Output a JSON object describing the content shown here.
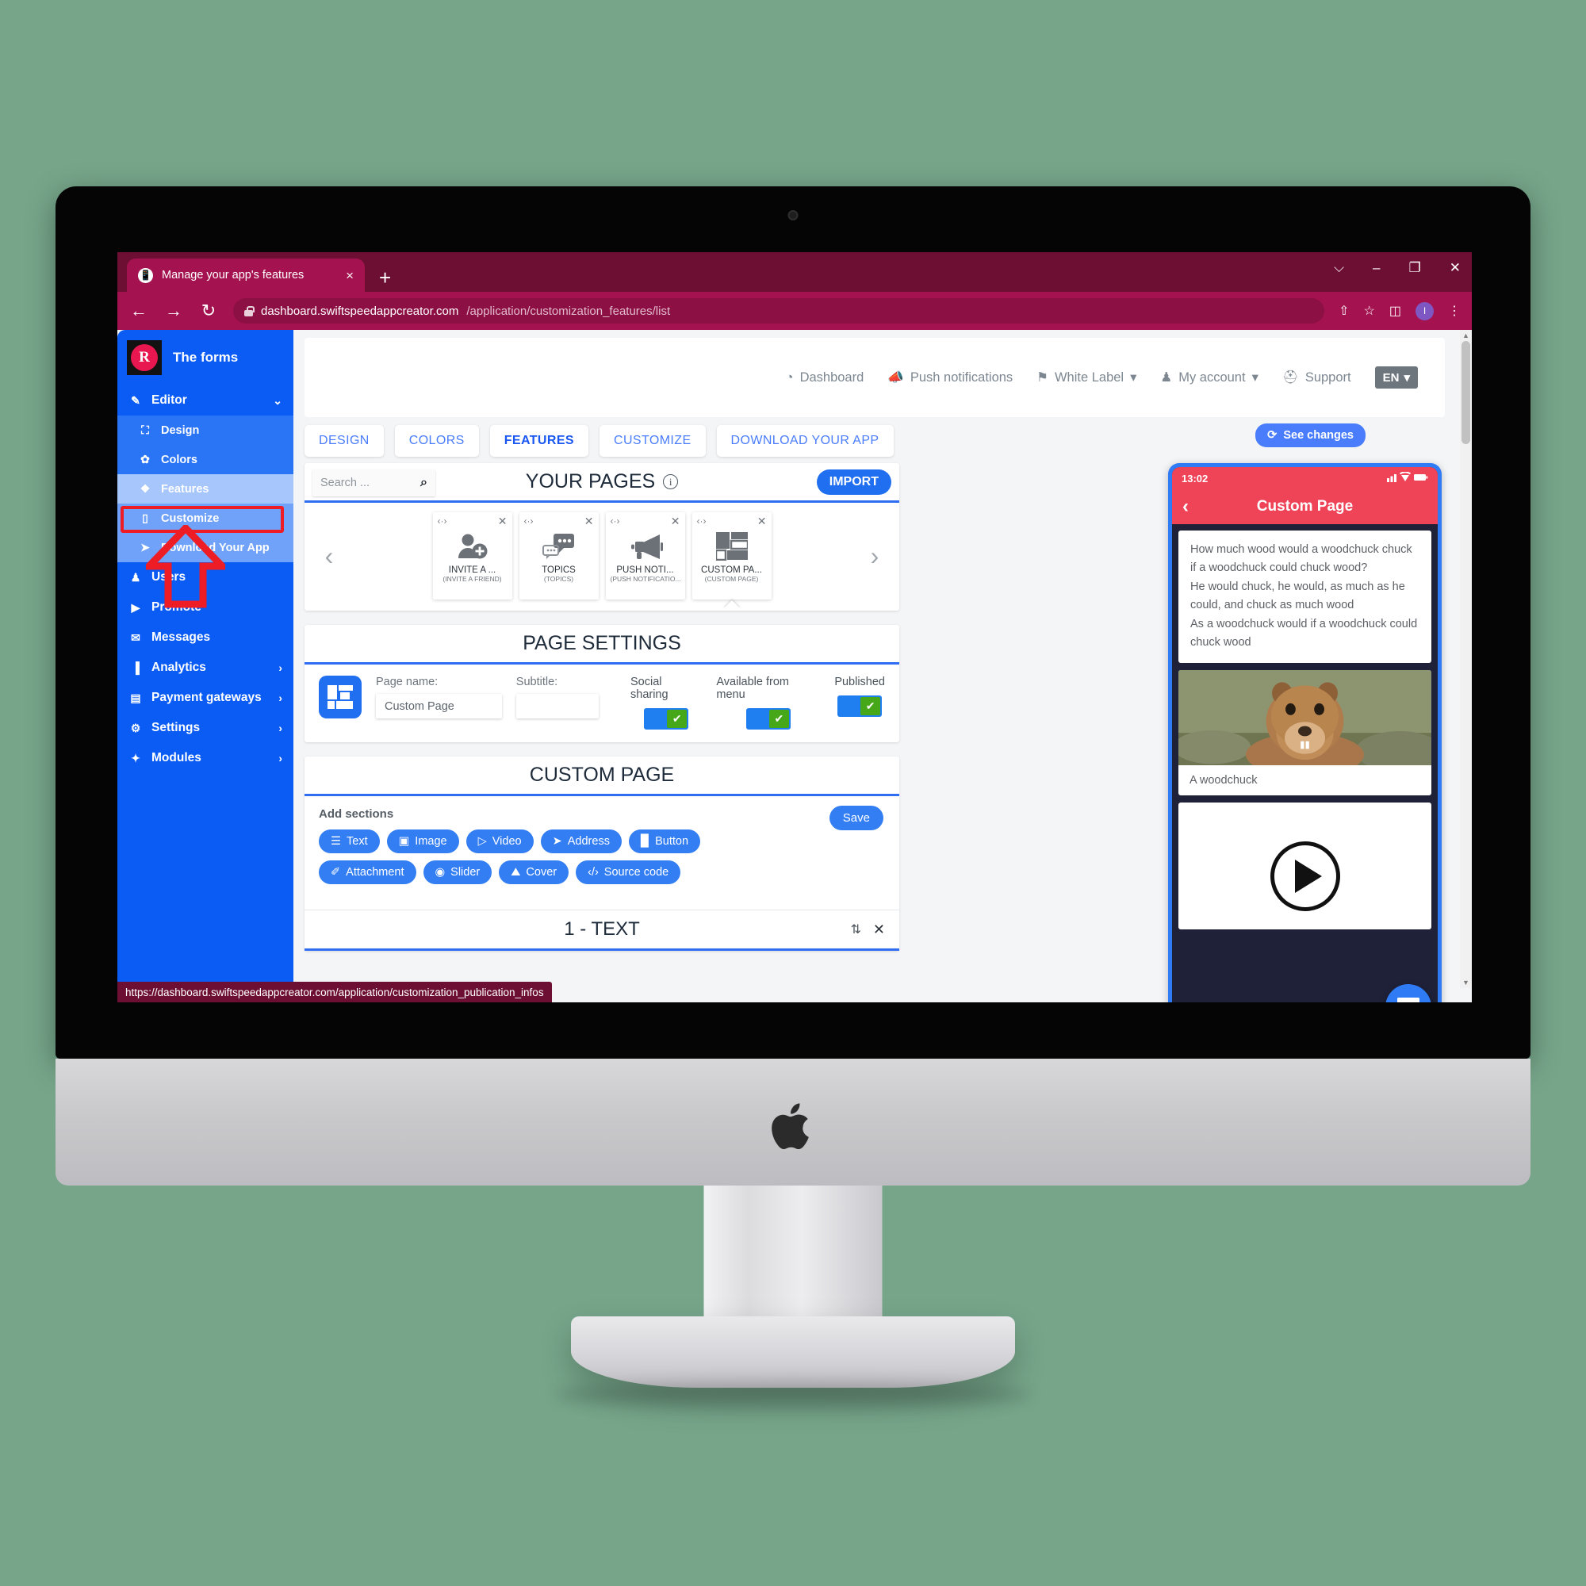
{
  "browser": {
    "tab_title": "Manage your app's features",
    "tab_close": "×",
    "new_tab": "+",
    "win_minimize": "–",
    "win_maximize": "❐",
    "win_close": "✕",
    "win_chevron": "⌵",
    "back": "←",
    "forward": "→",
    "reload": "↻",
    "url_host": "dashboard.swiftspeedappcreator.com",
    "url_path": "/application/customization_features/list",
    "share_icon": "⇧",
    "star_icon": "☆",
    "sidepanel_icon": "◫",
    "profile_initial": "I",
    "menu_icon": "⋮",
    "status_url": "https://dashboard.swiftspeedappcreator.com/application/customization_publication_infos"
  },
  "sidebar": {
    "brand_letter": "R",
    "brand_name": "The forms",
    "editor_label": "Editor",
    "editor_chevron": "⌄",
    "sub_items": [
      {
        "label": "Design",
        "icon": "⛶"
      },
      {
        "label": "Colors",
        "icon": "✿"
      },
      {
        "label": "Features",
        "icon": "❖"
      },
      {
        "label": "Customize",
        "icon": "▯"
      },
      {
        "label": "Download Your App",
        "icon": "➤"
      }
    ],
    "root_items": [
      {
        "label": "Users",
        "icon": "♟",
        "chevron": ""
      },
      {
        "label": "Promote",
        "icon": "▶",
        "chevron": ""
      },
      {
        "label": "Messages",
        "icon": "✉",
        "chevron": ""
      },
      {
        "label": "Analytics",
        "icon": "▐",
        "chevron": "›"
      },
      {
        "label": "Payment gateways",
        "icon": "▤",
        "chevron": "›"
      },
      {
        "label": "Settings",
        "icon": "⚙",
        "chevron": "›"
      },
      {
        "label": "Modules",
        "icon": "✦",
        "chevron": "›"
      }
    ]
  },
  "topnav": {
    "items": [
      {
        "label": "Dashboard",
        "icon": "◔",
        "caret": ""
      },
      {
        "label": "Push notifications",
        "icon": "📣",
        "caret": ""
      },
      {
        "label": "White Label",
        "icon": "⚑",
        "caret": "▾"
      },
      {
        "label": "My account",
        "icon": "♟",
        "caret": "▾"
      },
      {
        "label": "Support",
        "icon": "⛑",
        "caret": ""
      }
    ],
    "language": "EN",
    "language_caret": "▾"
  },
  "editor_tabs": [
    {
      "label": "DESIGN",
      "active": false
    },
    {
      "label": "COLORS",
      "active": false
    },
    {
      "label": "FEATURES",
      "active": true
    },
    {
      "label": "CUSTOMIZE",
      "active": false
    },
    {
      "label": "DOWNLOAD YOUR APP",
      "active": false
    }
  ],
  "see_changes": {
    "label": "See changes",
    "icon": "⟳"
  },
  "your_pages": {
    "title": "YOUR PAGES",
    "info_icon": "i",
    "search_placeholder": "Search ...",
    "search_value": "",
    "search_icon": "⌕",
    "import_label": "IMPORT",
    "prev_arrow": "‹",
    "next_arrow": "›",
    "cards": [
      {
        "name": "INVITE A ...",
        "sub": "(INVITE A FRIEND)",
        "code_icon": "‹·›",
        "close_icon": "✕",
        "selected": false
      },
      {
        "name": "TOPICS",
        "sub": "(TOPICS)",
        "code_icon": "‹·›",
        "close_icon": "✕",
        "selected": false
      },
      {
        "name": "PUSH NOTI...",
        "sub": "(PUSH NOTIFICATIO...",
        "code_icon": "‹·›",
        "close_icon": "✕",
        "selected": false
      },
      {
        "name": "CUSTOM PA...",
        "sub": "(CUSTOM PAGE)",
        "code_icon": "‹·›",
        "close_icon": "✕",
        "selected": true
      }
    ]
  },
  "page_settings": {
    "title": "PAGE SETTINGS",
    "page_name_label": "Page name:",
    "page_name_value": "Custom Page",
    "subtitle_label": "Subtitle:",
    "subtitle_value": "",
    "toggles": [
      {
        "label": "Social sharing",
        "checked": true,
        "check": "✔"
      },
      {
        "label": "Available from menu",
        "checked": true,
        "check": "✔"
      },
      {
        "label": "Published",
        "checked": true,
        "check": "✔"
      }
    ]
  },
  "custom_page": {
    "title": "CUSTOM PAGE",
    "add_sections_label": "Add sections",
    "save_label": "Save",
    "section_chips": [
      {
        "label": "Text",
        "icon": "☰"
      },
      {
        "label": "Image",
        "icon": "▣"
      },
      {
        "label": "Video",
        "icon": "▷"
      },
      {
        "label": "Address",
        "icon": "➤"
      },
      {
        "label": "Button",
        "icon": "▉"
      },
      {
        "label": "Attachment",
        "icon": "✐"
      },
      {
        "label": "Slider",
        "icon": "◉"
      },
      {
        "label": "Cover",
        "icon": "⛰"
      },
      {
        "label": "Source code",
        "icon": "‹/›"
      }
    ],
    "text_section": {
      "title": "1 - TEXT",
      "sort_icon": "⇅",
      "delete_icon": "✕"
    }
  },
  "preview": {
    "status_time": "13:02",
    "signal_icon": "▁▃▅",
    "wifi_icon": "▲",
    "battery_icon": "▬",
    "back_icon": "‹",
    "title": "Custom Page",
    "text_block": "How much wood would a woodchuck chuck if a woodchuck could chuck wood?\nHe would chuck, he would, as much as he could, and chuck as much wood\nAs a woodchuck would if a woodchuck could chuck wood",
    "image_caption": "A woodchuck",
    "chat_icon": "▭"
  },
  "colors": {
    "browser_chrome": "#a4134f",
    "browser_chrome_dark": "#6d0f33",
    "sidebar_blue": "#0a5cf5",
    "accent_blue": "#337ef3",
    "highlight_red": "#ee1c25",
    "toggle_green": "#46a818",
    "phone_header_red": "#ef4358",
    "phone_bg_dark": "#1e2138"
  }
}
